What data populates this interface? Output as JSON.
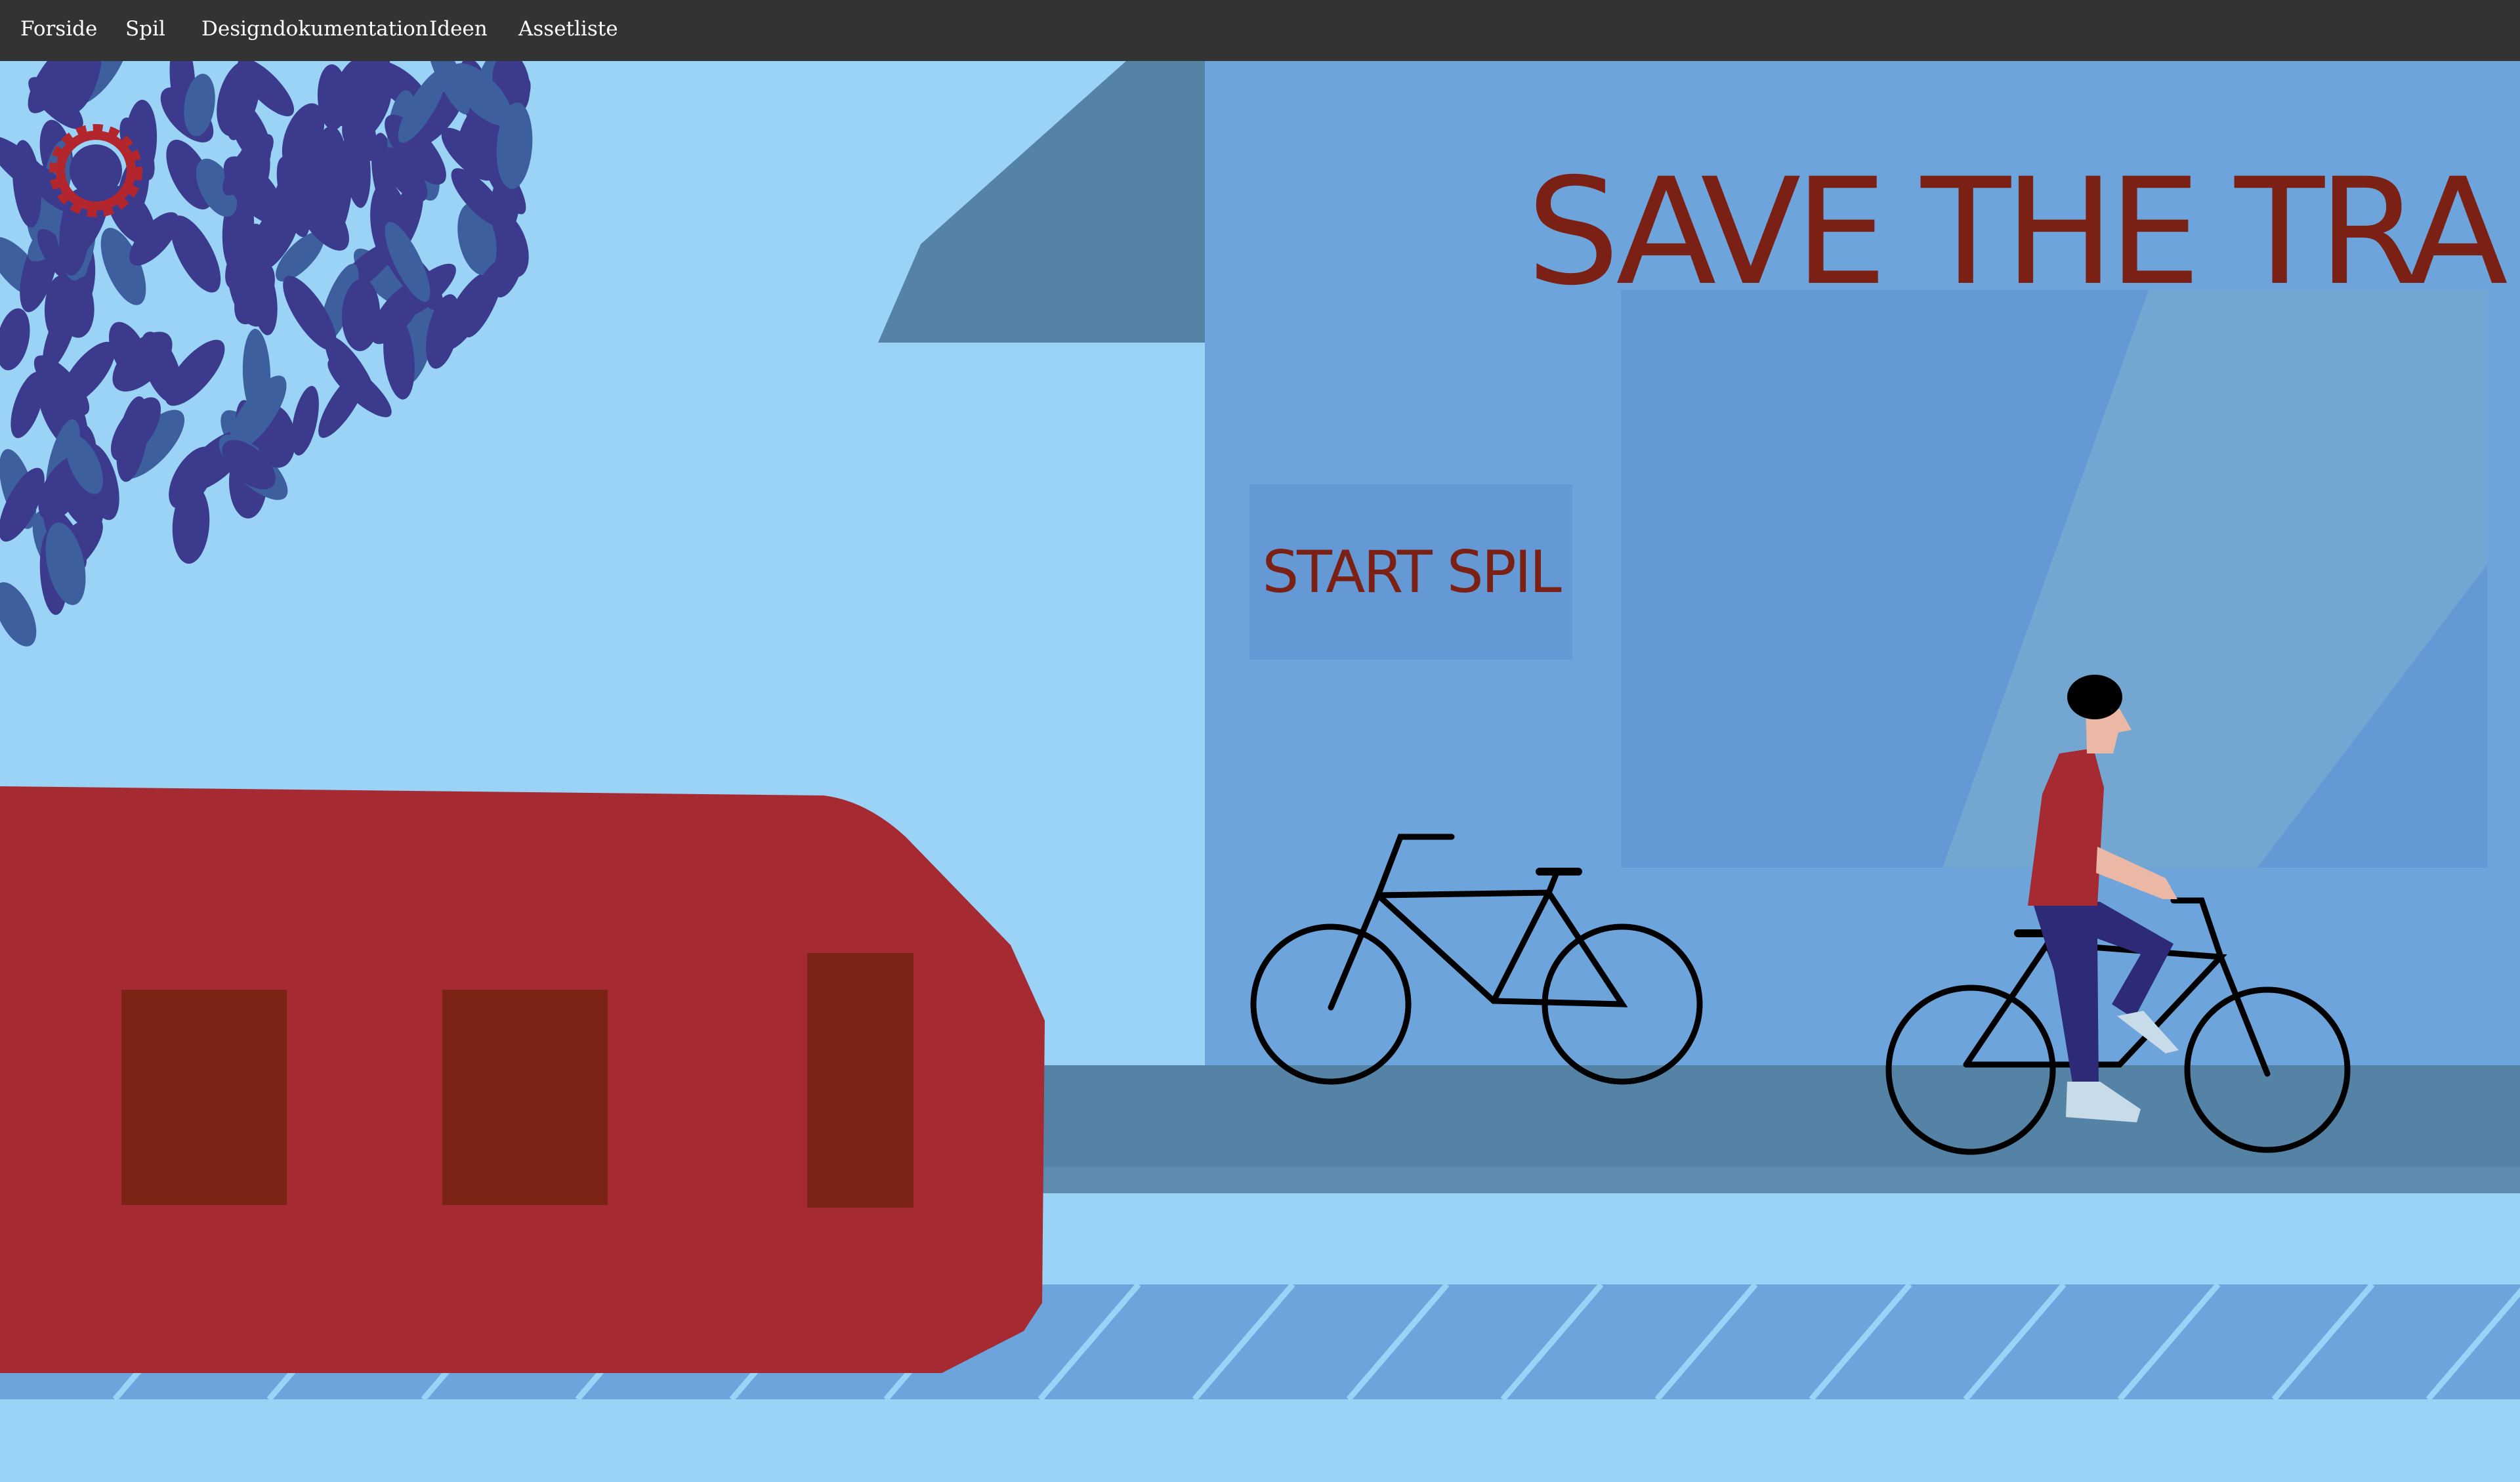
{
  "nav": {
    "items": [
      {
        "label": "Forside"
      },
      {
        "label": "Spil"
      },
      {
        "label": "Designdokumentation"
      },
      {
        "label": "Ideen"
      },
      {
        "label": "Assetliste"
      }
    ]
  },
  "game": {
    "title": "SAVE THE TRAIN",
    "start_label": "START SPIL",
    "icons": [
      "gear-icon",
      "tree-leaves",
      "building",
      "train",
      "parked-bicycle",
      "cyclist",
      "railway-track"
    ]
  },
  "colors": {
    "navbar": "#333333",
    "sky": "#9bd3f7",
    "building": "#6ea4dc",
    "roof": "#5583a6",
    "title": "#7b2014",
    "train": "#a62a31",
    "train_window": "#7b2416",
    "leaves": "#3b3a8c",
    "track": "#6ea4dc"
  }
}
